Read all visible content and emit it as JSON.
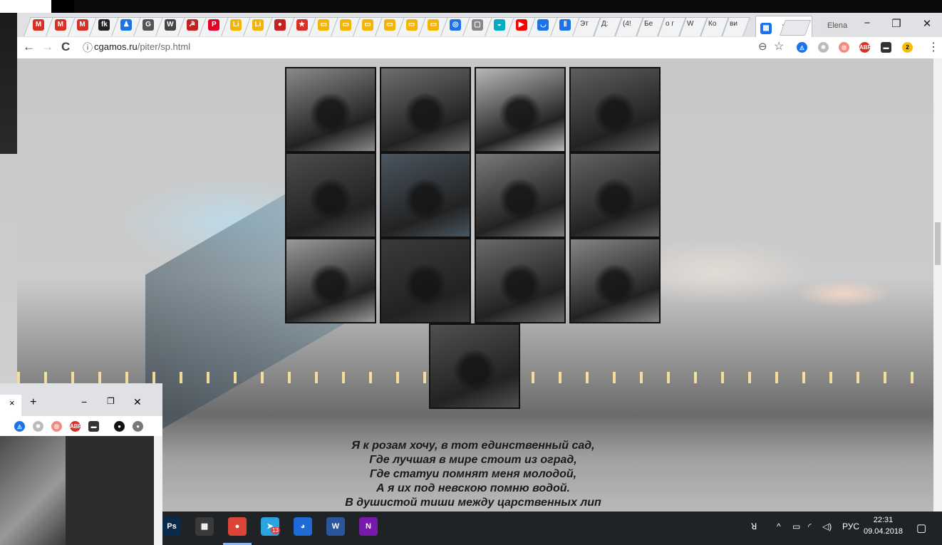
{
  "browser": {
    "url_host": "cgamos.ru",
    "url_path": "/piter/sp.html",
    "user_label": "Elena",
    "tab_labels": [
      "Эт",
      "Д:",
      "(4!",
      "Бе",
      "о г",
      "W",
      "Ко",
      "ви"
    ],
    "active_tab_close": "×",
    "window_controls": {
      "minimize": "−",
      "restore": "❐",
      "close": "✕"
    },
    "nav": {
      "back": "←",
      "forward": "→",
      "reload": "C",
      "info": "ⓘ"
    },
    "zoom_icon": "⊖",
    "star_icon": "☆",
    "menu_icon": "⋮"
  },
  "gallery": {
    "photos": [
      {
        "name": "photo-street-walker",
        "tone": "#8a8a8a"
      },
      {
        "name": "photo-bronze-horseman",
        "tone": "#6e6e6e"
      },
      {
        "name": "photo-bridge-spire",
        "tone": "#b8b8b8"
      },
      {
        "name": "photo-couple-walking",
        "tone": "#5e5e5e"
      },
      {
        "name": "photo-garden-statue",
        "tone": "#4c4c4c"
      },
      {
        "name": "photo-vintage-car-color",
        "tone": "#4a5660"
      },
      {
        "name": "photo-vintage-car-bw",
        "tone": "#7a7a7a"
      },
      {
        "name": "photo-woman-street",
        "tone": "#626262"
      },
      {
        "name": "photo-cathedral",
        "tone": "#9a9a9a"
      },
      {
        "name": "photo-three-friends",
        "tone": "#3a3a3a"
      },
      {
        "name": "photo-motorcycle",
        "tone": "#6a6a6a"
      },
      {
        "name": "photo-monument-square",
        "tone": "#848484"
      },
      {
        "name": "photo-young-man",
        "tone": "#505050"
      }
    ]
  },
  "poem": {
    "lines": [
      "Я к розам хочу, в тот единственный сад,",
      "Где лучшая в мире стоит из оград,",
      "Где статуи помнят меня молодой,",
      "А я их под невскою помню водой.",
      "В душистой тиши между царственных лип"
    ]
  },
  "second_window": {
    "new_tab": "+",
    "tab_close": "×",
    "minimize": "−",
    "restore": "❐",
    "close": "✕"
  },
  "taskbar": {
    "apps": [
      {
        "name": "photoshop",
        "glyph": "Ps",
        "color": "#0a2a4a"
      },
      {
        "name": "calendar-app",
        "glyph": "▦",
        "color": "#3a3a3a"
      },
      {
        "name": "chrome",
        "glyph": "●",
        "color": "#db4437"
      },
      {
        "name": "telegram",
        "glyph": "➤",
        "color": "#2aa3df"
      },
      {
        "name": "firefox",
        "glyph": "◕",
        "color": "#1e6bd6"
      },
      {
        "name": "word",
        "glyph": "W",
        "color": "#2b579a"
      },
      {
        "name": "onenote",
        "glyph": "N",
        "color": "#7719aa"
      }
    ],
    "language": "РУС",
    "time": "22:31",
    "date": "09.04.2018",
    "telegram_badge": "13"
  }
}
